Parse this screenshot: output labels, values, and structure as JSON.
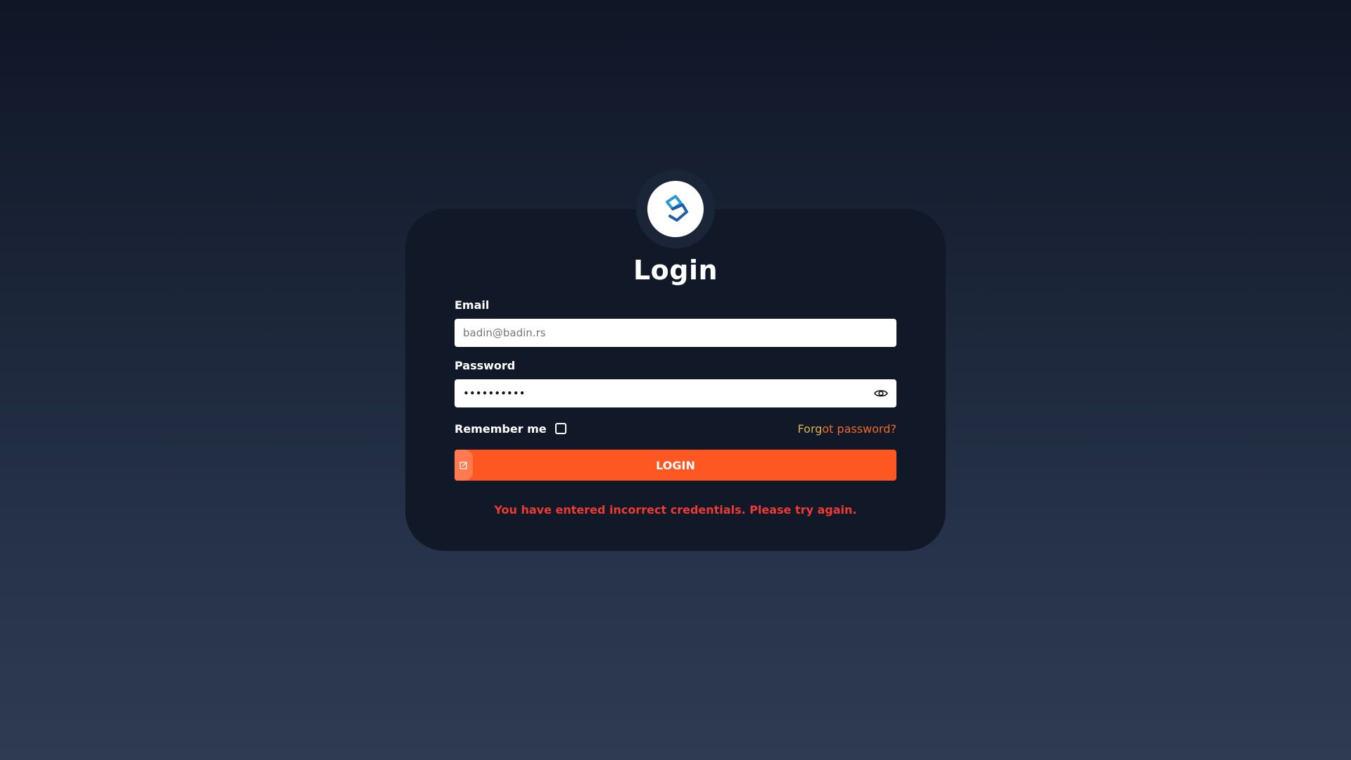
{
  "login": {
    "title": "Login",
    "email_label": "Email",
    "email_value": "badin@badin.rs",
    "password_label": "Password",
    "password_value": "••••••••••",
    "remember_label": "Remember me",
    "forgot_prefix": "Forg",
    "forgot_rest": "ot password?",
    "login_button": "LOGIN",
    "error_message": "You have entered incorrect credentials. Please try again."
  },
  "icons": {
    "logo": "badin-logo-icon",
    "show_password": "eye-icon",
    "button_tab": "edit-icon"
  },
  "colors": {
    "accent": "#ff5722",
    "error": "#ef3b34",
    "card_bg": "#111828",
    "forgot_link": "#f06a2a"
  }
}
